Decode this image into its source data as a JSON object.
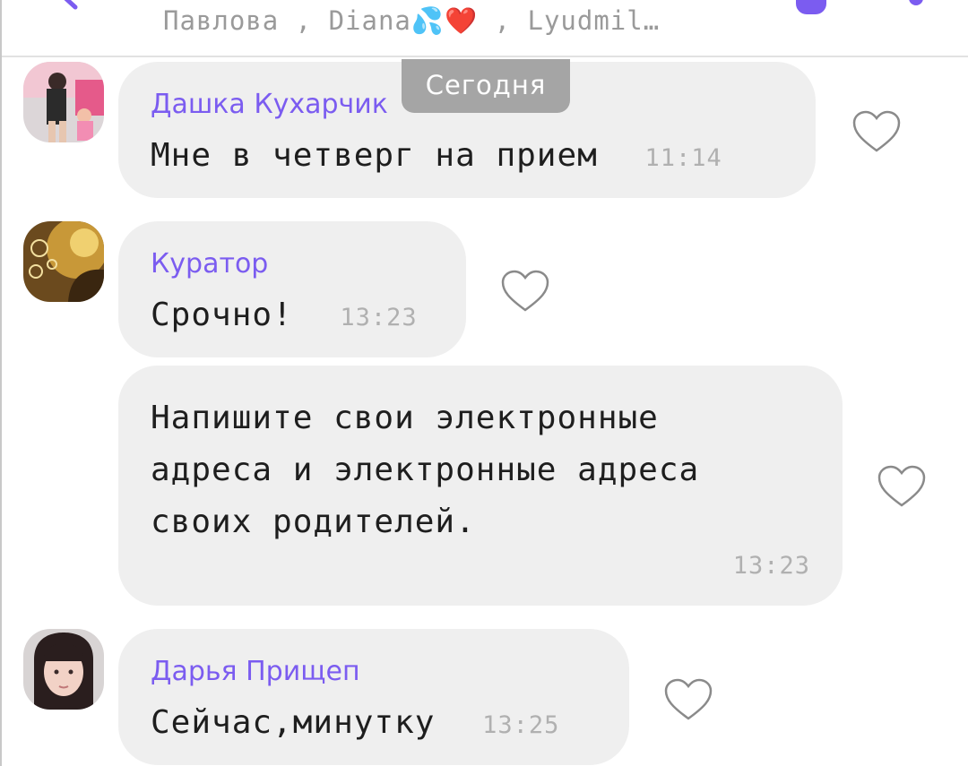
{
  "header": {
    "participants": "Павлова , Diana💦❤️ , Lyudmil…"
  },
  "date_separator": "Сегодня",
  "messages": [
    {
      "sender": "Дашка Кухарчик",
      "text": "Мне в четверг на прием",
      "time": "11:14"
    },
    {
      "sender": "Куратор",
      "text": "Срочно!",
      "time": "13:23"
    },
    {
      "lines": [
        "Напишите свои электронные",
        "адреса и электронные адреса",
        "своих родителей."
      ],
      "time": "13:23"
    },
    {
      "sender": "Дарья Прищеп",
      "text": "Сейчас,минутку",
      "time": "13:25"
    }
  ],
  "colors": {
    "accent": "#7b5cf0",
    "bubble": "#efefef",
    "date_pill": "#a5a5a5",
    "time": "#b0b0b0"
  },
  "icons": {
    "back": "arrow-left-icon",
    "like": "heart-outline-icon"
  }
}
